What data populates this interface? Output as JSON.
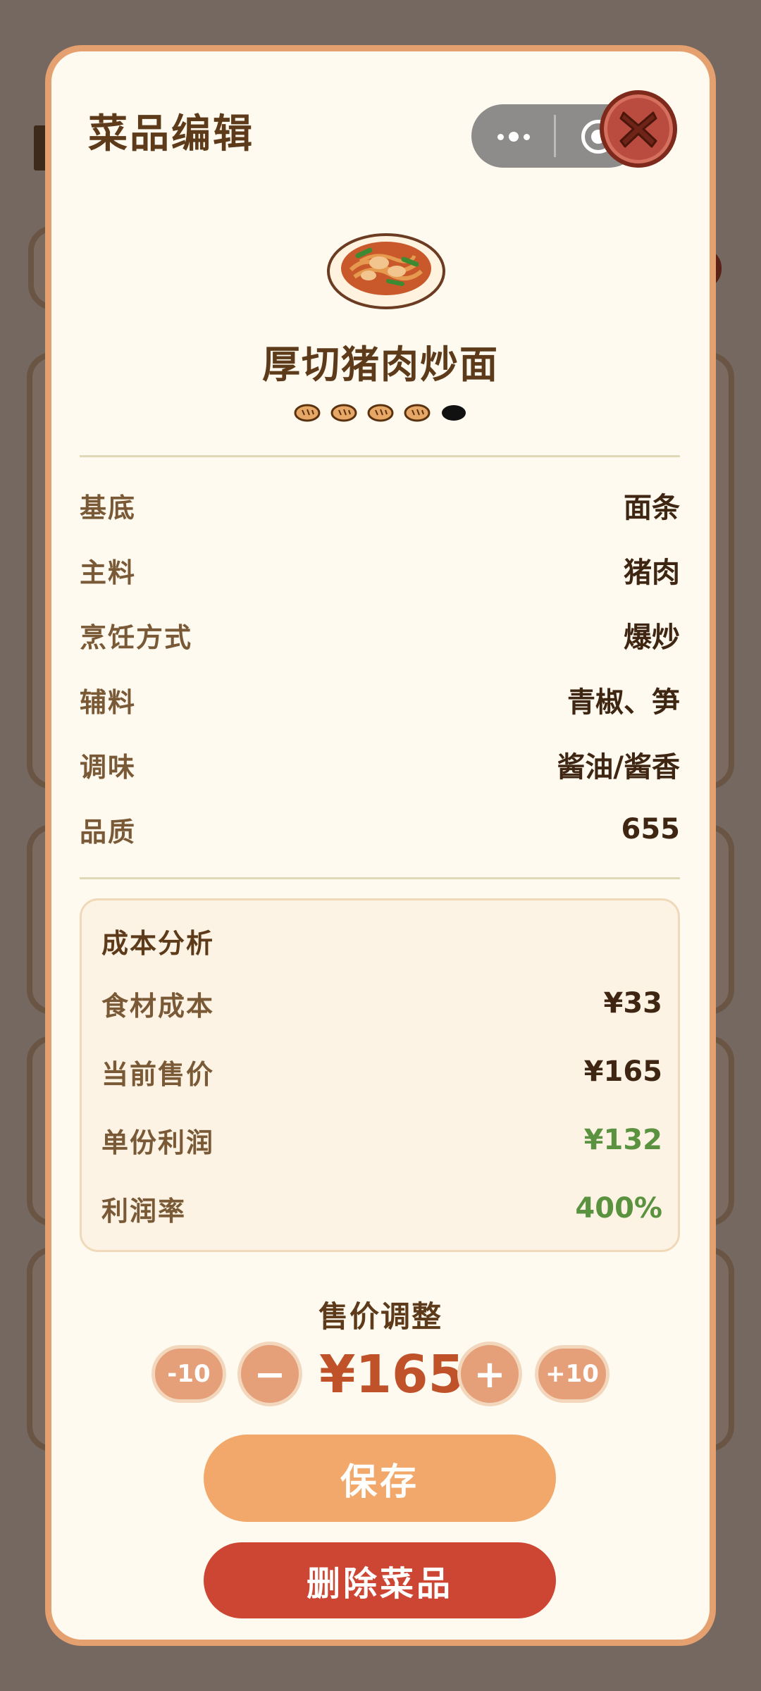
{
  "modal": {
    "title": "菜品编辑",
    "close_icon": "close-icon"
  },
  "capsule": {
    "more_icon": "more-dots-icon",
    "target_icon": "target-icon"
  },
  "dish": {
    "image_icon": "noodle-dish-icon",
    "name": "厚切猪肉炒面",
    "rating": {
      "filled": 4,
      "max": 5,
      "icon": "bread-icon"
    }
  },
  "details": [
    {
      "label": "基底",
      "value": "面条"
    },
    {
      "label": "主料",
      "value": "猪肉"
    },
    {
      "label": "烹饪方式",
      "value": "爆炒"
    },
    {
      "label": "辅料",
      "value": "青椒、笋"
    },
    {
      "label": "调味",
      "value": "酱油/酱香"
    },
    {
      "label": "品质",
      "value": "655"
    }
  ],
  "cost": {
    "title": "成本分析",
    "rows": [
      {
        "label": "食材成本",
        "value": "¥33"
      },
      {
        "label": "当前售价",
        "value": "¥165"
      },
      {
        "label": "单份利润",
        "value": "¥132"
      },
      {
        "label": "利润率",
        "value": "400%"
      }
    ]
  },
  "price_adjust": {
    "title": "售价调整",
    "minus10": "-10",
    "minus": "−",
    "price": "¥165",
    "plus": "+",
    "plus10": "+10"
  },
  "buttons": {
    "save": "保存",
    "delete": "删除菜品"
  },
  "colors": {
    "accent": "#f2a86a",
    "danger": "#cd4634",
    "positive": "#5a9240",
    "price": "#c0522a"
  }
}
